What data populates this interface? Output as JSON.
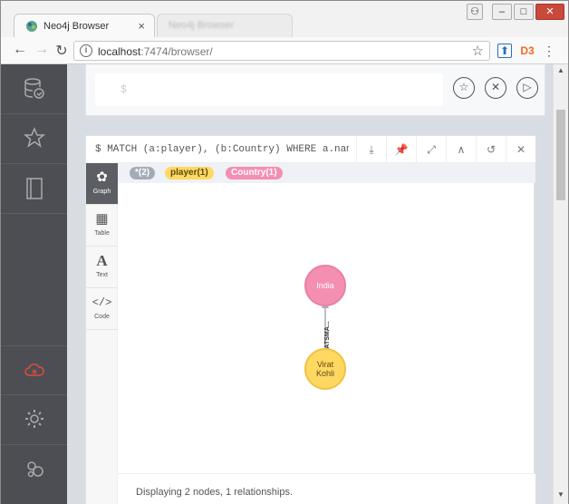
{
  "browser": {
    "tab_title": "Neo4j Browser",
    "tab_close": "×",
    "second_tab_title": "Neo4j Browser",
    "window_controls": {
      "minimize": "–",
      "maximize": "□",
      "close": "✕",
      "user": "⚇"
    },
    "url_host": "localhost",
    "url_path": ":7474/browser/",
    "menu_glyph": "⋮"
  },
  "editor": {
    "prompt": "$"
  },
  "result": {
    "query": "$ MATCH (a:player), (b:Country) WHERE a.name...",
    "view_tabs": [
      {
        "label": "Graph",
        "icon": "graph-icon"
      },
      {
        "label": "Table",
        "icon": "table-icon"
      },
      {
        "label": "Text",
        "icon": "text-icon"
      },
      {
        "label": "Code",
        "icon": "code-icon"
      }
    ],
    "legend": {
      "all": "*(2)",
      "player": "player(1)",
      "country": "Country(1)"
    },
    "nodes": {
      "country": "India",
      "player_line1": "Virat",
      "player_line2": "Kohli"
    },
    "relationship": "BATSMA...",
    "status": "Displaying 2 nodes, 1 relationships."
  },
  "colors": {
    "sidebar": "#4d4e53",
    "country_node": "#f48fb1",
    "player_node": "#ffd862",
    "all_pill": "#a5abb6",
    "error_icon": "#e14b3b"
  }
}
